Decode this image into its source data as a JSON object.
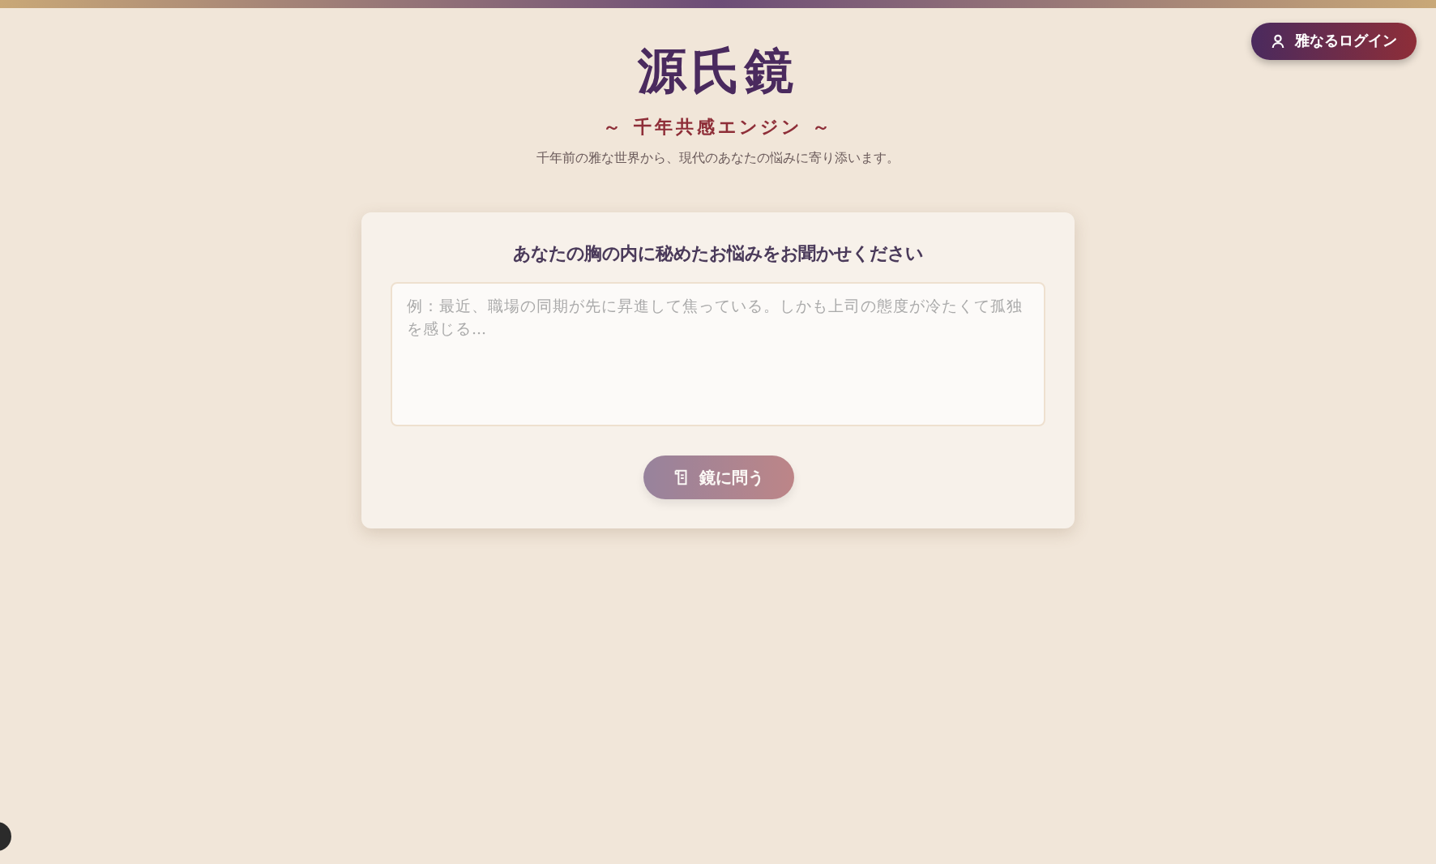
{
  "header": {
    "login_button": "雅なるログイン"
  },
  "hero": {
    "title": "源氏鏡",
    "subtitle": "～ 千年共感エンジン ～",
    "tagline": "千年前の雅な世界から、現代のあなたの悩みに寄り添います。"
  },
  "form": {
    "heading": "あなたの胸の内に秘めたお悩みをお聞かせください",
    "textarea": {
      "placeholder": "例：最近、職場の同期が先に昇進して焦っている。しかも上司の態度が冷たくて孤独を感じる..."
    },
    "submit": {
      "label": "鏡に問う",
      "disabled": true
    }
  }
}
